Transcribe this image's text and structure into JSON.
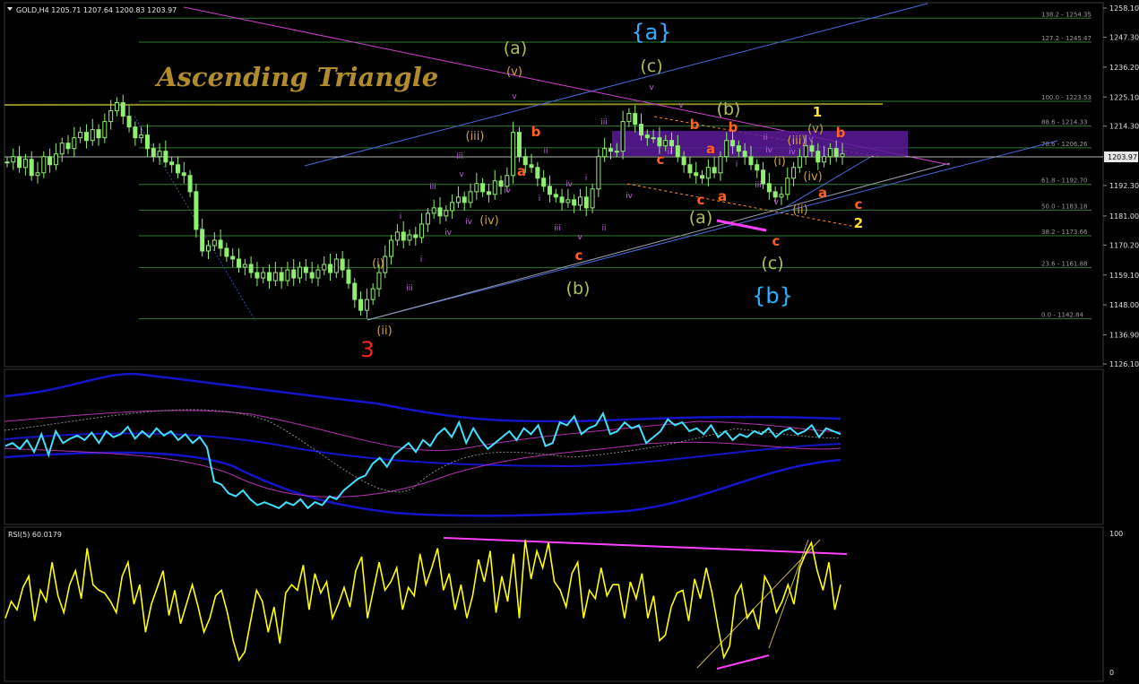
{
  "header": {
    "menu_icon": "triangle-down-icon",
    "info": "GOLD,H4  1205.71 1207.64 1200.83 1203.97"
  },
  "title": "Ascending Triangle",
  "rsi_label": "RSI(5) 60.0179",
  "colors": {
    "candle": "#90ee70",
    "grid": "#1f2f1f",
    "fib": "#2f7a2f",
    "resistance": "#8a8a20",
    "trend_blue": "#4a6ad8",
    "trend_magenta": "#d040d0",
    "box": "#5a1a9a",
    "label_orange": "#ff6020",
    "label_green": "#a8c050",
    "label_cyan": "#30b0ff",
    "label_yellow": "#ffe030",
    "label_violet": "#c060e0",
    "label_red": "#ff2020",
    "label_tan": "#d0a040",
    "title": "#b08c2a",
    "osc_cyan": "#40e0ff",
    "osc_blue": "#1414c8",
    "rsi": "#ffff00"
  },
  "chart_data": [
    {
      "type": "candlestick",
      "symbol": "GOLD",
      "timeframe": "H4",
      "last": 1203.97,
      "ylim": [
        1126.1,
        1258.1
      ],
      "yticks": [
        "1258.10",
        "1247.30",
        "1236.20",
        "1225.10",
        "1214.30",
        "1203.97",
        "1192.30",
        "1181.00",
        "1170.20",
        "1159.10",
        "1148.00",
        "1136.90",
        "1126.10"
      ],
      "close_series": [
        1201,
        1203,
        1199,
        1202,
        1196,
        1197,
        1203,
        1200,
        1204,
        1208,
        1206,
        1210,
        1212,
        1209,
        1213,
        1210,
        1216,
        1220,
        1223,
        1218,
        1214,
        1210,
        1211,
        1206,
        1203,
        1205,
        1201,
        1200,
        1197,
        1196,
        1190,
        1176,
        1168,
        1170,
        1172,
        1169,
        1166,
        1165,
        1162,
        1163,
        1160,
        1158,
        1160,
        1157,
        1160,
        1157,
        1161,
        1158,
        1162,
        1160,
        1158,
        1161,
        1163,
        1160,
        1165,
        1161,
        1156,
        1150,
        1146,
        1150,
        1154,
        1160,
        1166,
        1172,
        1175,
        1172,
        1174,
        1173,
        1178,
        1182,
        1184,
        1181,
        1183,
        1186,
        1188,
        1186,
        1190,
        1193,
        1190,
        1189,
        1194,
        1192,
        1196,
        1212,
        1203,
        1200,
        1199,
        1195,
        1192,
        1189,
        1188,
        1186,
        1187,
        1185,
        1188,
        1184,
        1191,
        1203,
        1206,
        1205,
        1205,
        1216,
        1219,
        1215,
        1211,
        1210,
        1210,
        1207,
        1209,
        1207,
        1203,
        1200,
        1197,
        1196,
        1195,
        1199,
        1197,
        1203,
        1209,
        1207,
        1205,
        1203,
        1200,
        1198,
        1193,
        1190,
        1188,
        1189,
        1195,
        1199,
        1203,
        1207,
        1205,
        1201,
        1203,
        1206,
        1203,
        1204
      ],
      "fibonacci": [
        {
          "level": "138.2",
          "price": "1254.35"
        },
        {
          "level": "127.2",
          "price": "1245.47"
        },
        {
          "level": "100.0",
          "price": "1223.53"
        },
        {
          "level": "88.6",
          "price": "1214.33"
        },
        {
          "level": "78.6",
          "price": "1206.26"
        },
        {
          "level": "61.8",
          "price": "1192.70"
        },
        {
          "level": "50.0",
          "price": "1183.18"
        },
        {
          "level": "38.2",
          "price": "1173.66"
        },
        {
          "level": "23.6",
          "price": "1161.88"
        },
        {
          "level": "0.0",
          "price": "1142.84"
        }
      ],
      "wave_labels": {
        "big": [
          "{a}",
          "{b}"
        ],
        "green": [
          "(a)",
          "(c)",
          "(b)",
          "(b)",
          "(a)",
          "(c)"
        ],
        "orange": [
          "b",
          "a",
          "c",
          "b",
          "a",
          "c",
          "b",
          "c",
          "a",
          "b",
          "c",
          "a",
          "c"
        ],
        "tan": [
          "(v)",
          "(iii)",
          "(iv)",
          "(i)",
          "(ii)",
          "(iii)",
          "(i)",
          "(iv)",
          "(v)",
          "(ii)"
        ],
        "violet": [
          "v",
          "ii",
          "iii",
          "iv",
          "i",
          "iv",
          "iii",
          "v",
          "ii",
          "i",
          "v",
          "iii",
          "iv",
          "i",
          "iii",
          "iv",
          "i",
          "v",
          "ii",
          "iv",
          "i",
          "ii",
          "iv",
          "v",
          "v",
          "iv",
          "iii",
          "v",
          "iii"
        ],
        "yellow": [
          "1",
          "2"
        ],
        "red": [
          "3"
        ]
      }
    },
    {
      "type": "line",
      "panel": "oscillator_envelope",
      "series": [
        {
          "values": [
            50,
            52,
            48,
            54,
            46,
            58,
            44,
            60,
            52,
            55,
            57,
            54,
            59,
            52,
            60,
            56,
            58,
            63,
            55,
            60,
            56,
            62,
            57,
            60,
            54,
            58,
            52,
            56,
            49,
            26,
            24,
            18,
            16,
            20,
            14,
            10,
            12,
            10,
            8,
            12,
            10,
            14,
            8,
            12,
            10,
            16,
            14,
            20,
            24,
            28,
            30,
            38,
            42,
            36,
            44,
            48,
            52,
            46,
            54,
            50,
            58,
            62,
            56,
            66,
            52,
            62,
            54,
            48,
            52,
            56,
            60,
            54,
            62,
            58,
            64,
            50,
            52,
            66,
            64,
            70,
            58,
            62,
            64,
            72,
            58,
            60,
            66,
            62,
            64,
            52,
            56,
            60,
            68,
            64,
            66,
            60,
            62,
            58,
            64,
            56,
            60,
            54,
            58,
            56,
            60,
            58,
            62,
            56,
            60,
            62,
            58,
            60,
            64,
            56,
            62,
            60,
            58
          ]
        }
      ]
    },
    {
      "type": "line",
      "panel": "rsi",
      "title": "RSI(5) 60.0179",
      "ylim": [
        0,
        100
      ],
      "yticks": [
        "100",
        "0"
      ],
      "series": [
        {
          "name": "RSI(5)",
          "values": [
            40,
            52,
            46,
            62,
            70,
            38,
            60,
            52,
            80,
            56,
            44,
            64,
            74,
            54,
            90,
            64,
            60,
            58,
            52,
            44,
            70,
            80,
            50,
            64,
            30,
            50,
            62,
            74,
            42,
            60,
            36,
            50,
            64,
            48,
            30,
            40,
            56,
            60,
            44,
            24,
            10,
            16,
            38,
            60,
            52,
            30,
            48,
            22,
            58,
            64,
            60,
            78,
            46,
            72,
            58,
            66,
            40,
            50,
            62,
            48,
            74,
            84,
            40,
            60,
            80,
            60,
            66,
            76,
            46,
            62,
            56,
            86,
            64,
            76,
            90,
            60,
            72,
            46,
            64,
            40,
            56,
            82,
            66,
            88,
            44,
            70,
            52,
            86,
            40,
            96,
            68,
            88,
            76,
            94,
            66,
            60,
            48,
            72,
            80,
            40,
            60,
            54,
            76,
            56,
            64,
            64,
            40,
            66,
            54,
            72,
            40,
            56,
            24,
            28,
            48,
            58,
            60,
            38,
            68,
            54,
            76,
            58,
            34,
            12,
            20,
            56,
            64,
            40,
            46,
            32,
            70,
            62,
            44,
            52,
            64,
            50,
            76,
            86,
            94,
            74,
            60,
            80,
            46,
            64
          ]
        }
      ]
    }
  ]
}
